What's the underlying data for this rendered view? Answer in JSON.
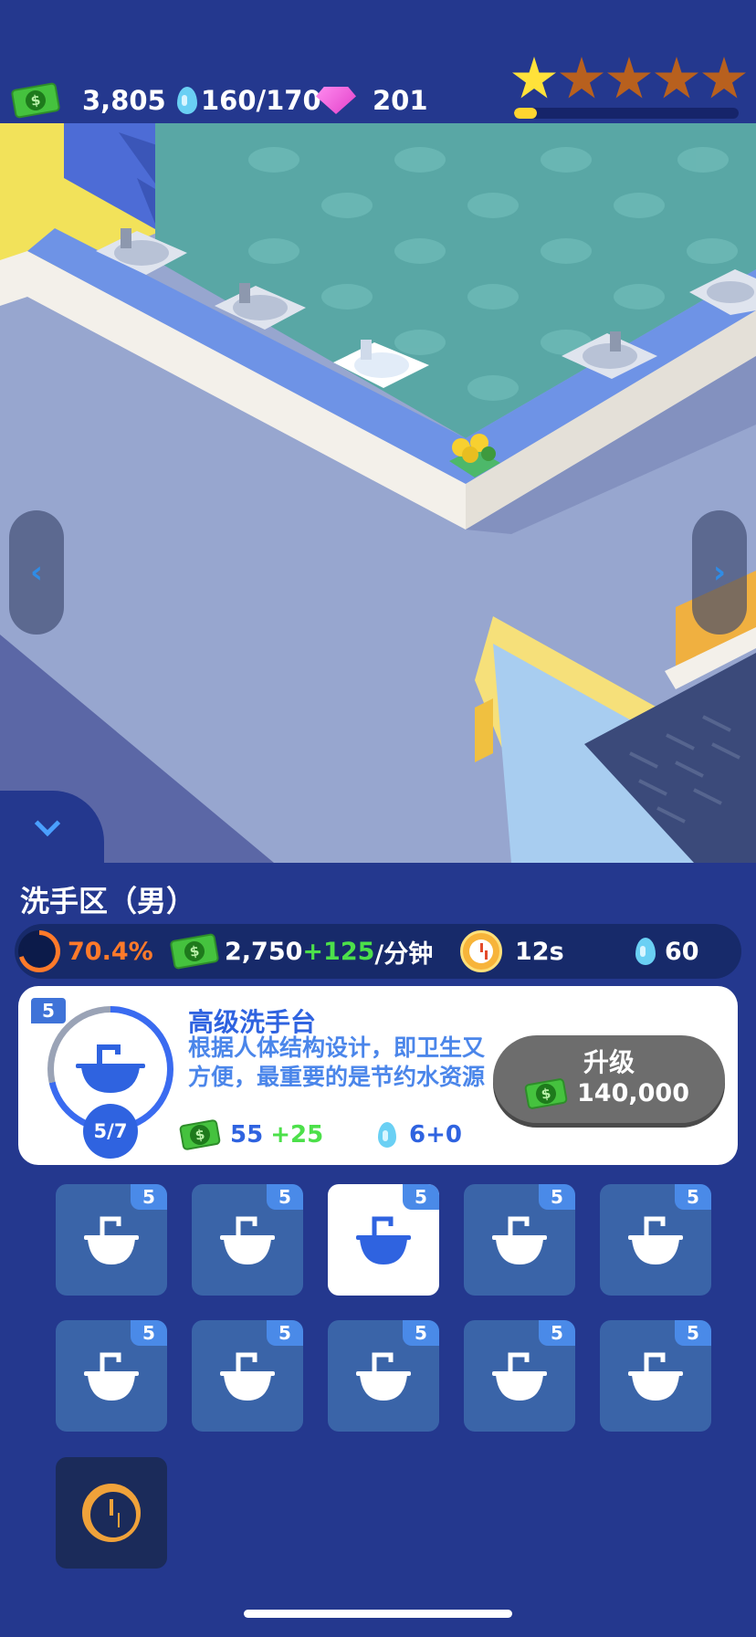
{
  "resources": {
    "cash": "3,805",
    "water": "160/170",
    "gems": "201"
  },
  "rating": {
    "stars_filled": 1,
    "stars_total": 5,
    "progress": 0.1
  },
  "panel": {
    "title": "洗手区（男）",
    "stats": {
      "cleanliness": "70.4%",
      "cleanliness_value": 0.704,
      "income": "2,750",
      "income_bonus": "+125",
      "income_unit": "/分钟",
      "time": "12s",
      "water": "60"
    }
  },
  "item": {
    "badge": "5",
    "name": "高级洗手台",
    "description": "根据人体结构设计，即卫生又方便，最重要的是节约水资源",
    "level": "5/7",
    "level_progress": 0.714,
    "income": "55",
    "income_bonus": "+25",
    "water": "6+0",
    "upgrade_label": "升级",
    "upgrade_price": "140,000"
  },
  "slots": [
    {
      "badge": "5",
      "selected": false
    },
    {
      "badge": "5",
      "selected": false
    },
    {
      "badge": "5",
      "selected": true
    },
    {
      "badge": "5",
      "selected": false
    },
    {
      "badge": "5",
      "selected": false
    },
    {
      "badge": "5",
      "selected": false
    },
    {
      "badge": "5",
      "selected": false
    },
    {
      "badge": "5",
      "selected": false
    },
    {
      "badge": "5",
      "selected": false
    },
    {
      "badge": "5",
      "selected": false
    }
  ],
  "colors": {
    "background": "#24388e",
    "accent_blue": "#2f63e0",
    "cash_green": "#45c23e",
    "bonus_green": "#4ce04a",
    "cleanliness_orange": "#ff7a2a",
    "star_gold": "#ffe23a"
  },
  "icons": {
    "cash": "cash-icon",
    "water": "water-drop-icon",
    "gem": "gem-icon",
    "star": "star-icon",
    "timer": "clock-icon",
    "sink": "sink-icon"
  }
}
